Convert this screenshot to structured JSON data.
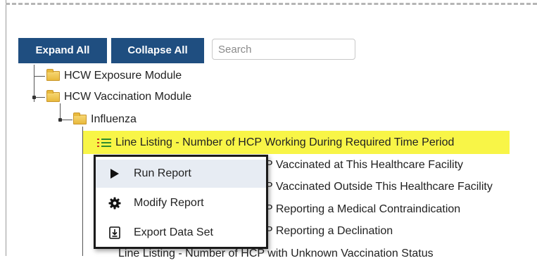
{
  "toolbar": {
    "expand_all_label": "Expand All",
    "collapse_all_label": "Collapse All",
    "search_placeholder": "Search"
  },
  "tree": {
    "modules": [
      {
        "label": "HCW Exposure Module"
      },
      {
        "label": "HCW Vaccination Module"
      }
    ],
    "influenza_label": "Influenza",
    "reports": [
      {
        "label": "Line Listing - Number of HCP Working During Required Time Period",
        "selected": true
      },
      {
        "label": "P Vaccinated at This Healthcare Facility"
      },
      {
        "label": "P Vaccinated Outside This Healthcare Facility"
      },
      {
        "label": "P Reporting a Medical Contraindication"
      },
      {
        "label": "P Reporting a Declination"
      },
      {
        "label": "Line Listing - Number of HCP with Unknown Vaccination Status"
      }
    ]
  },
  "context_menu": {
    "items": [
      {
        "label": "Run Report",
        "icon": "play-icon"
      },
      {
        "label": "Modify Report",
        "icon": "gear-icon"
      },
      {
        "label": "Export Data Set",
        "icon": "export-icon"
      }
    ]
  },
  "colors": {
    "button_bg": "#1f4e80",
    "highlight": "#f8f547",
    "folder": "#e8b93d",
    "list_icon_green": "#2e8b2e",
    "list_icon_red": "#c8391f"
  }
}
